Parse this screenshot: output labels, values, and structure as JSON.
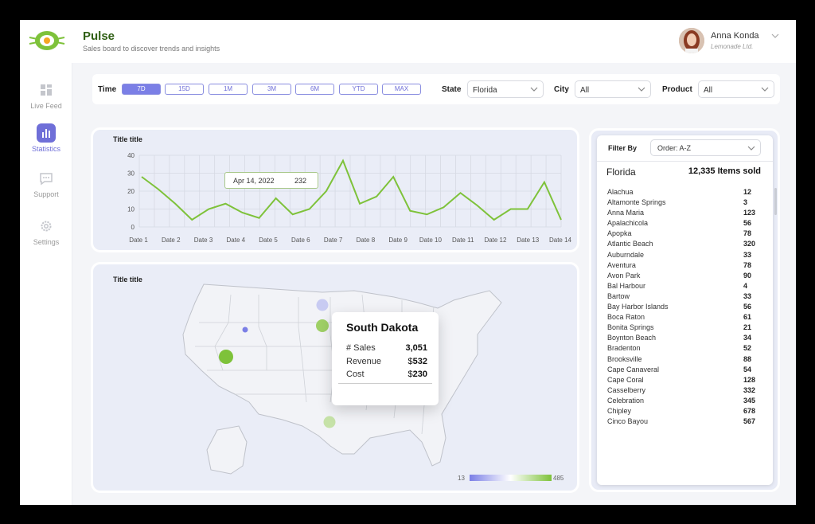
{
  "app": {
    "title": "Pulse",
    "subtitle": "Sales board to discover trends and insights"
  },
  "user": {
    "name": "Anna Konda",
    "org": "Lemonade Ltd."
  },
  "sidebar": {
    "items": [
      {
        "label": "Live Feed",
        "icon": "dashboard-icon"
      },
      {
        "label": "Statistics",
        "icon": "bar-chart-icon",
        "active": true
      },
      {
        "label": "Support",
        "icon": "chat-icon"
      },
      {
        "label": "Settings",
        "icon": "gear-icon"
      }
    ]
  },
  "filters": {
    "time_label": "Time",
    "time_ranges": [
      "7D",
      "15D",
      "1M",
      "3M",
      "6M",
      "YTD",
      "MAX"
    ],
    "time_selected": "7D",
    "state_label": "State",
    "state_value": "Florida",
    "city_label": "City",
    "city_value": "All",
    "product_label": "Product",
    "product_value": "All"
  },
  "line_card": {
    "title": "Title title",
    "tooltip": {
      "date": "Apr 14, 2022",
      "value": "232"
    }
  },
  "chart_data": {
    "type": "line",
    "title": "Title title",
    "categories": [
      "Date 1",
      "Date 2",
      "Date 3",
      "Date 4",
      "Date 5",
      "Date 6",
      "Date 7",
      "Date 8",
      "Date 9",
      "Date 10",
      "Date 11",
      "Date 12",
      "Date 13",
      "Date 14"
    ],
    "x_points": [
      1,
      2,
      3,
      4,
      5,
      6,
      7,
      8,
      9,
      10,
      11,
      12,
      13,
      14,
      15,
      16,
      17,
      18,
      19,
      20,
      21,
      22,
      23,
      24,
      25,
      26,
      27,
      28
    ],
    "values": [
      28,
      21,
      13,
      4,
      10,
      13,
      8,
      5,
      16,
      7,
      10,
      20,
      37,
      13,
      17,
      28,
      9,
      7,
      11,
      19,
      12,
      4,
      10,
      10,
      25,
      4
    ],
    "ylim": [
      0,
      40
    ],
    "yticks": [
      0,
      10,
      20,
      30,
      40
    ],
    "grid": true,
    "color": "#7ec23a"
  },
  "map_card": {
    "title": "Title title",
    "tooltip": {
      "state": "South Dakota",
      "rows": [
        {
          "label": "# Sales",
          "value": "3,051",
          "prefix": ""
        },
        {
          "label": "Revenue",
          "value": "532",
          "prefix": "$"
        },
        {
          "label": "Cost",
          "value": "230",
          "prefix": "$"
        }
      ]
    },
    "legend": {
      "min": "13",
      "max": "485"
    }
  },
  "right_panel": {
    "filter_label": "Filter By",
    "order": "Order: A-Z",
    "state": "Florida",
    "total": "12,335 Items sold",
    "cities": [
      [
        "Alachua",
        "12"
      ],
      [
        "Altamonte Springs",
        "3"
      ],
      [
        "Anna Maria",
        "123"
      ],
      [
        "Apalachicola",
        "56"
      ],
      [
        "Apopka",
        "78"
      ],
      [
        "Atlantic Beach",
        "320"
      ],
      [
        "Auburndale",
        "33"
      ],
      [
        "Aventura",
        "78"
      ],
      [
        "Avon Park",
        "90"
      ],
      [
        "Bal Harbour",
        "4"
      ],
      [
        "Bartow",
        "33"
      ],
      [
        "Bay Harbor Islands",
        "56"
      ],
      [
        "Boca Raton",
        "61"
      ],
      [
        "Bonita Springs",
        "21"
      ],
      [
        "Boynton Beach",
        "34"
      ],
      [
        "Bradenton",
        "52"
      ],
      [
        "Brooksville",
        "88"
      ],
      [
        "Cape Canaveral",
        "54"
      ],
      [
        "Cape Coral",
        "128"
      ],
      [
        "Casselberry",
        "332"
      ],
      [
        "Celebration",
        "345"
      ],
      [
        "Chipley",
        "678"
      ],
      [
        "Cinco Bayou",
        "567"
      ]
    ]
  },
  "colors": {
    "accent": "#6f6fd8",
    "green": "#7ec23a",
    "brand": "#2f5f14"
  }
}
